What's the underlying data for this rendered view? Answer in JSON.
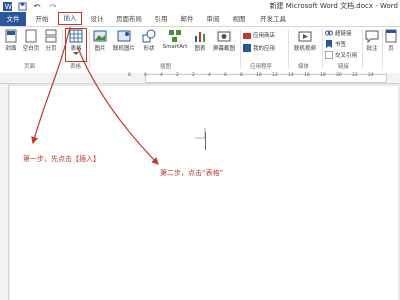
{
  "window": {
    "title": "新建 Microsoft Word 文档.docx - Word"
  },
  "quick_access": {
    "icons": [
      "word-logo-icon",
      "save-icon",
      "undo-icon",
      "redo-icon"
    ]
  },
  "tabs": [
    {
      "id": "file",
      "label": "文件"
    },
    {
      "id": "home",
      "label": "开始"
    },
    {
      "id": "insert",
      "label": "插入"
    },
    {
      "id": "design",
      "label": "设计"
    },
    {
      "id": "layout",
      "label": "页面布局"
    },
    {
      "id": "references",
      "label": "引用"
    },
    {
      "id": "mailings",
      "label": "邮件"
    },
    {
      "id": "review",
      "label": "审阅"
    },
    {
      "id": "view",
      "label": "视图"
    },
    {
      "id": "developer",
      "label": "开发工具"
    }
  ],
  "ribbon": {
    "groups": {
      "pages": "页面",
      "tables": "表格",
      "illustrations": "插图",
      "apps": "应用程序",
      "media": "媒体",
      "links": "链接"
    },
    "buttons": {
      "cover": "封面",
      "blank_page": "空白页",
      "page_break": "分页",
      "table": "表格",
      "pictures": "图片",
      "online_pictures": "联机图片",
      "shapes": "形状",
      "smartart": "SmartArt",
      "chart": "图表",
      "screenshot": "屏幕截图",
      "store": "应用商店",
      "my_apps": "我的应用",
      "online_video": "联机视频",
      "hyperlink": "超链接",
      "bookmark": "书签",
      "cross_reference": "交叉引用",
      "comment": "批注",
      "header": "页"
    }
  },
  "ruler": {
    "numbers": [
      "8",
      "6",
      "4",
      "2",
      "2",
      "4",
      "6",
      "8",
      "10",
      "12",
      "14",
      "16",
      "18",
      "20",
      "22",
      "24"
    ]
  },
  "annotations": {
    "step1": "第一步，先点击【插入】",
    "step2": "第二步，点击“表格”"
  },
  "colors": {
    "accent": "#2b579a",
    "annotation": "#c0392b"
  }
}
